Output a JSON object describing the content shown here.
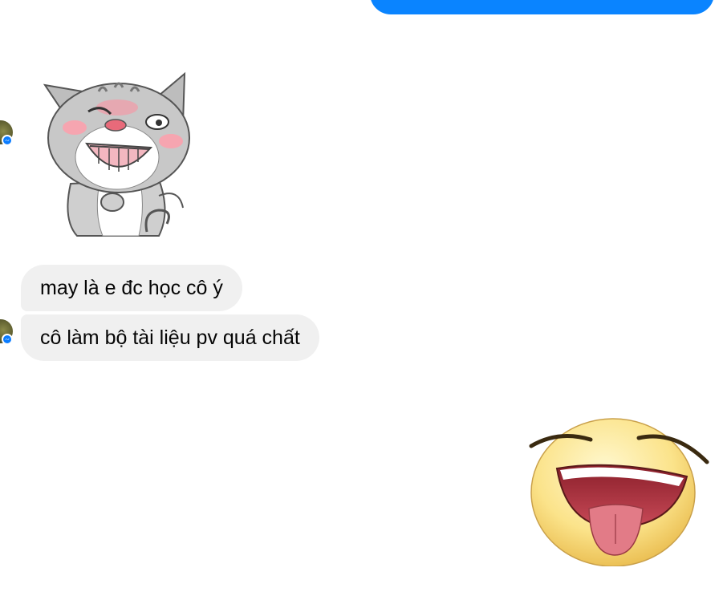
{
  "messages": {
    "received_1": "may là e đc học cô ý",
    "received_2": "cô làm bộ tài liệu pv quá chất"
  },
  "stickers": {
    "cat": "cat-wink-sticker",
    "emoji": "tongue-out-laughing-emoji"
  },
  "colors": {
    "sent_bubble": "#0a84ff",
    "received_bubble": "#f0f0f0",
    "messenger_badge": "#0a7cff"
  }
}
